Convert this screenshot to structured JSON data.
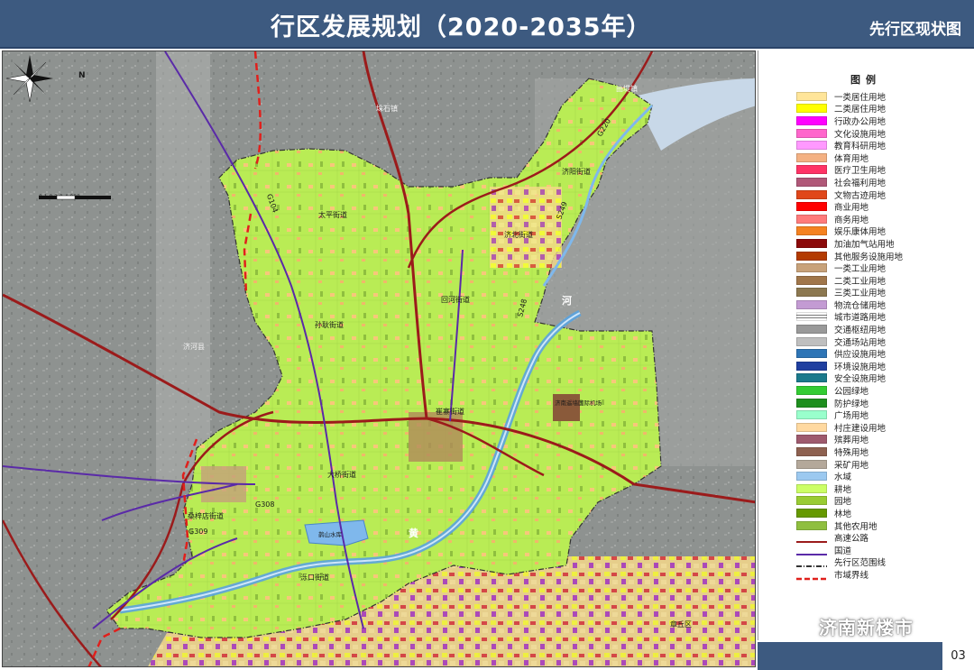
{
  "header": {
    "title": "行区发展规划（2020-2035年）",
    "subtitle": "先行区现状图"
  },
  "legend": {
    "title": "图例",
    "items": [
      {
        "label": "一类居住用地",
        "color": "#ffe599",
        "kind": "fill"
      },
      {
        "label": "二类居住用地",
        "color": "#ffff00",
        "kind": "fill"
      },
      {
        "label": "行政办公用地",
        "color": "#ff00ff",
        "kind": "fill"
      },
      {
        "label": "文化设施用地",
        "color": "#ff66cc",
        "kind": "fill"
      },
      {
        "label": "教育科研用地",
        "color": "#ff99ff",
        "kind": "fill"
      },
      {
        "label": "体育用地",
        "color": "#f4b183",
        "kind": "fill"
      },
      {
        "label": "医疗卫生用地",
        "color": "#ff3366",
        "kind": "fill"
      },
      {
        "label": "社会福利用地",
        "color": "#b05878",
        "kind": "fill"
      },
      {
        "label": "文物古迹用地",
        "color": "#e0471a",
        "kind": "fill"
      },
      {
        "label": "商业用地",
        "color": "#ff0000",
        "kind": "fill"
      },
      {
        "label": "商务用地",
        "color": "#ff7b7b",
        "kind": "fill"
      },
      {
        "label": "娱乐康体用地",
        "color": "#f58220",
        "kind": "fill"
      },
      {
        "label": "加油加气站用地",
        "color": "#8b0a0a",
        "kind": "fill"
      },
      {
        "label": "其他服务设施用地",
        "color": "#b33a00",
        "kind": "fill"
      },
      {
        "label": "一类工业用地",
        "color": "#c8a27a",
        "kind": "fill"
      },
      {
        "label": "二类工业用地",
        "color": "#a0764a",
        "kind": "fill"
      },
      {
        "label": "三类工业用地",
        "color": "#8c7850",
        "kind": "fill"
      },
      {
        "label": "物流仓储用地",
        "color": "#c39bd3",
        "kind": "fill"
      },
      {
        "label": "城市道路用地",
        "color": "#ffffff",
        "kind": "hatch"
      },
      {
        "label": "交通枢纽用地",
        "color": "#999999",
        "kind": "fill"
      },
      {
        "label": "交通场站用地",
        "color": "#bfbfbf",
        "kind": "fill"
      },
      {
        "label": "供应设施用地",
        "color": "#2e75b6",
        "kind": "fill"
      },
      {
        "label": "环境设施用地",
        "color": "#1f3fa0",
        "kind": "fill"
      },
      {
        "label": "安全设施用地",
        "color": "#1b7a8c",
        "kind": "fill"
      },
      {
        "label": "公园绿地",
        "color": "#33cc33",
        "kind": "fill"
      },
      {
        "label": "防护绿地",
        "color": "#1f8f1f",
        "kind": "fill"
      },
      {
        "label": "广场用地",
        "color": "#99ffcc",
        "kind": "fill"
      },
      {
        "label": "村庄建设用地",
        "color": "#ffd9a0",
        "kind": "fill"
      },
      {
        "label": "殡葬用地",
        "color": "#9e5a6e",
        "kind": "fill"
      },
      {
        "label": "特殊用地",
        "color": "#8e6150",
        "kind": "fill"
      },
      {
        "label": "采矿用地",
        "color": "#b4a89a",
        "kind": "fill"
      },
      {
        "label": "水域",
        "color": "#9cc9f0",
        "kind": "fill"
      },
      {
        "label": "耕地",
        "color": "#ccff66",
        "kind": "fill"
      },
      {
        "label": "园地",
        "color": "#99cc33",
        "kind": "fill"
      },
      {
        "label": "林地",
        "color": "#669900",
        "kind": "fill"
      },
      {
        "label": "其他农用地",
        "color": "#8fbf3f",
        "kind": "fill"
      },
      {
        "label": "高速公路",
        "color": "#9b1b1b",
        "kind": "line"
      },
      {
        "label": "国道",
        "color": "#5a2aa8",
        "kind": "line"
      },
      {
        "label": "先行区范围线",
        "color": "#333333",
        "kind": "dashdot"
      },
      {
        "label": "市域界线",
        "color": "#e0201c",
        "kind": "dash"
      }
    ]
  },
  "map_labels": {
    "north": "N",
    "scale": "0 1.0 2.0 4.000",
    "places": [
      {
        "text": "太平街道"
      },
      {
        "text": "济北街道"
      },
      {
        "text": "济阳街道"
      },
      {
        "text": "回河街道"
      },
      {
        "text": "孙耿街道"
      },
      {
        "text": "崔寨街道"
      },
      {
        "text": "大桥街道"
      },
      {
        "text": "桑梓店街道"
      },
      {
        "text": "泺口街道"
      },
      {
        "text": "济河县"
      },
      {
        "text": "曲堤镇"
      },
      {
        "text": "垛石镇"
      },
      {
        "text": "济南遥墙国际机场"
      },
      {
        "text": "鹊山水库"
      },
      {
        "text": "章丘区"
      }
    ],
    "roads": [
      "G104",
      "G220",
      "G309",
      "S248",
      "S249",
      "G308"
    ],
    "rivers": [
      "河",
      "黄"
    ]
  },
  "footer": {
    "page_number": "03",
    "watermark": "济南新楼市"
  }
}
